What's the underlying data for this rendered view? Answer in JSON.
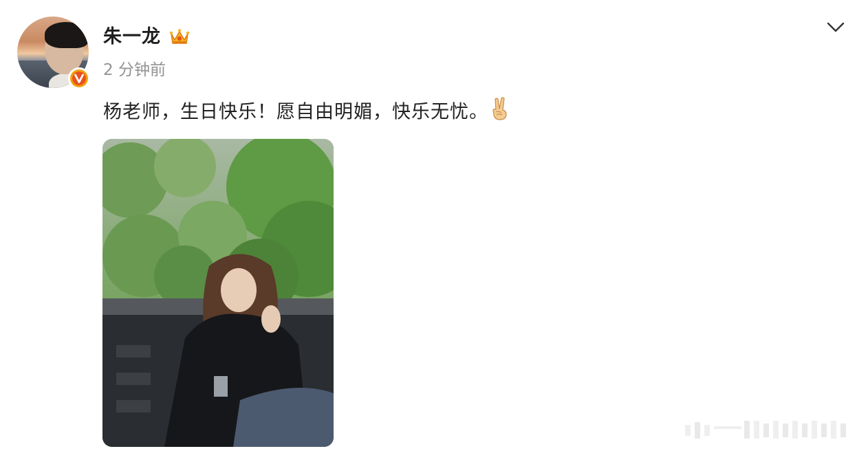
{
  "post": {
    "author": {
      "name": "朱一龙",
      "verified": true,
      "badge_icon": "verified-v-icon",
      "member_icon": "crown-icon"
    },
    "timestamp": "2 分钟前",
    "text": "杨老师，生日快乐！愿自由明媚，快乐无忧。",
    "text_emoji": "victory-hand-emoji",
    "images": [
      {
        "alt": "photo",
        "icon": "photo-thumbnail"
      }
    ],
    "menu_icon": "chevron-down-icon"
  },
  "colors": {
    "username": "#1f1f1f",
    "timestamp": "#939393",
    "text": "#222222",
    "verified_badge": "#f2a20c",
    "verified_badge_inner": "#e8531d",
    "chevron": "#333333"
  }
}
